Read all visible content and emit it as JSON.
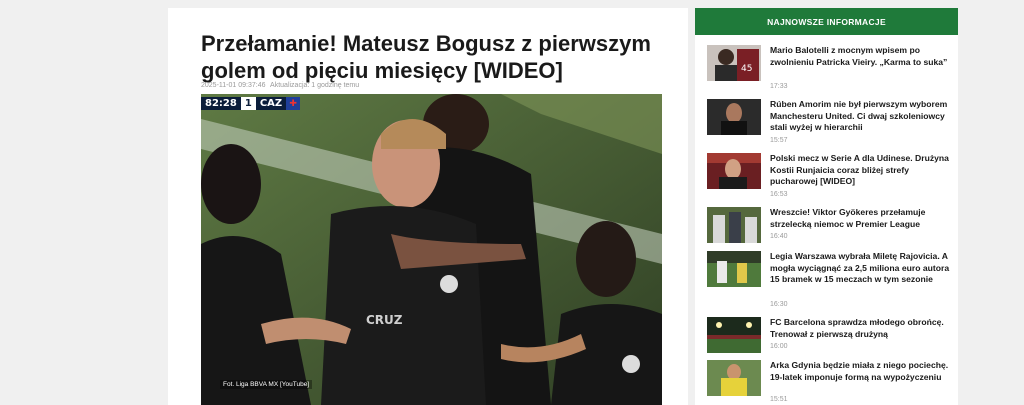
{
  "article": {
    "title": "Przełamanie! Mateusz Bogusz z pierwszym golem od pięciu miesięcy [WIDEO]",
    "date": "2025-11-01 09:37:46",
    "update": "Aktualizacja: 1 godzinę temu",
    "photo_caption": "Fot. Liga BBVA MX [YouTube]",
    "scorebug": {
      "time": "82:28",
      "score": "1",
      "team": "CAZ"
    }
  },
  "sidebar": {
    "header": "NAJNOWSZE INFORMACJE",
    "items": [
      {
        "title": "Mario Balotelli z mocnym wpisem po zwolnieniu Patricka Vieiry. „Karma to suka”",
        "time": "17:33"
      },
      {
        "title": "Rúben Amorim nie był pierwszym wyborem Manchesteru United. Ci dwaj szkoleniowcy stali wyżej w hierarchii",
        "time": "15:57"
      },
      {
        "title": "Polski mecz w Serie A dla Udinese. Drużyna Kostii Runjaicia coraz bliżej strefy pucharowej [WIDEO]",
        "time": "16:53"
      },
      {
        "title": "Wreszcie! Viktor Gyökeres przełamuje strzelecką niemoc w Premier League",
        "time": "16:40"
      },
      {
        "title": "Legia Warszawa wybrała Miletę Rajovicia. A mogła wyciągnąć za 2,5 miliona euro autora 15 bramek w 15 meczach w tym sezonie",
        "time": "16:30"
      },
      {
        "title": "FC Barcelona sprawdza młodego obrońcę. Trenował z pierwszą drużyną",
        "time": "16:00"
      },
      {
        "title": "Arka Gdynia będzie miała z niego pociechę. 19-latek imponuje formą na wypożyczeniu",
        "time": "15:51"
      }
    ]
  }
}
